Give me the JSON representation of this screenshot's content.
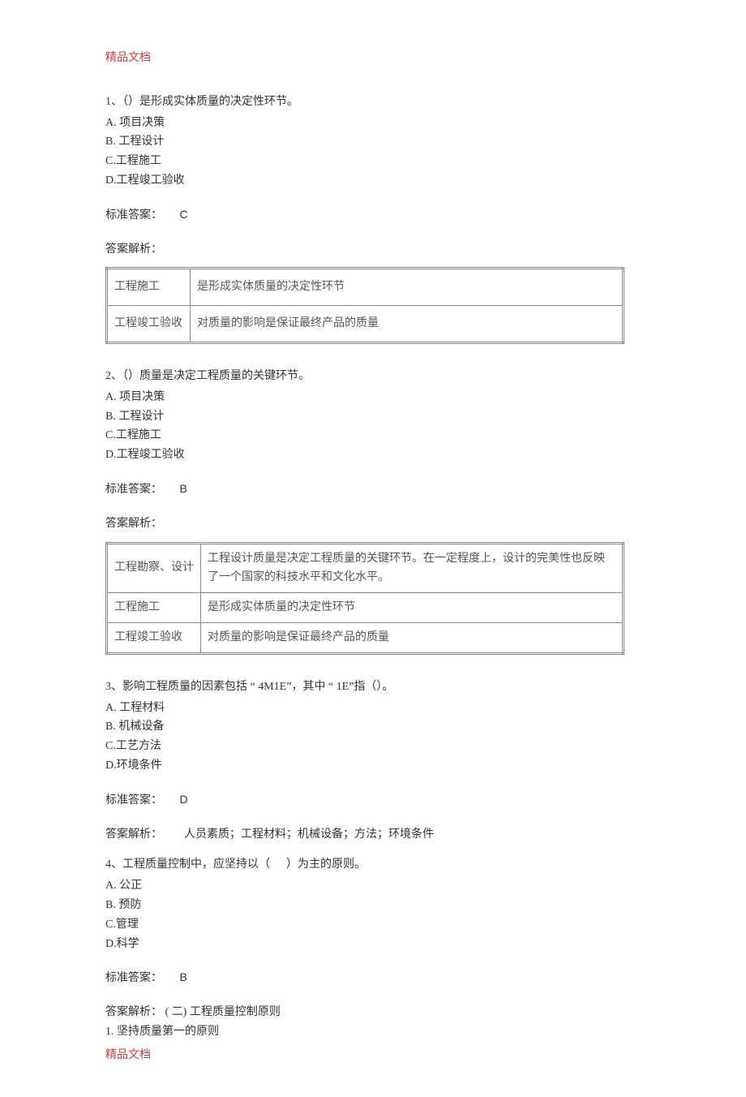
{
  "header": "精品文档",
  "footer": "精品文档",
  "q1": {
    "stem": "1、（）是形成实体质量的决定性环节。",
    "optA": "A. 项目决策",
    "optB": "B. 工程设计",
    "optC": "C.工程施工",
    "optD": "D.工程竣工验收",
    "answer_label": "标准答案：",
    "answer": "C",
    "analysis_label": "答案解析：",
    "table": [
      {
        "c1": "工程施工",
        "c2": "是形成实体质量的决定性环节"
      },
      {
        "c1": "工程竣工验收",
        "c2": "对质量的影响是保证最终产品的质量"
      }
    ]
  },
  "q2": {
    "stem": "2、（）质量是决定工程质量的关键环节。",
    "optA": "A. 项目决策",
    "optB": "B. 工程设计",
    "optC": "C.工程施工",
    "optD": "D.工程竣工验收",
    "answer_label": "标准答案：",
    "answer": "B",
    "analysis_label": "答案解析：",
    "table": [
      {
        "c1": "工程勘察、设计",
        "c2": "工程设计质量是决定工程质量的关键环节。在一定程度上，设计的完美性也反映了一个国家的科技水平和文化水平。"
      },
      {
        "c1": "工程施工",
        "c2": "是形成实体质量的决定性环节"
      },
      {
        "c1": "工程竣工验收",
        "c2": "对质量的影响是保证最终产品的质量"
      }
    ]
  },
  "q3": {
    "stem": "3、影响工程质量的因素包括 “ 4M1E”，其中 “ 1E”指（）。",
    "optA": "A. 工程材料",
    "optB": "B. 机械设备",
    "optC": "C.工艺方法",
    "optD": "D.环境条件",
    "answer_label": "标准答案：",
    "answer": "D",
    "analysis_label": "答案解析：",
    "analysis_text": "人员素质；工程材料；机械设备；方法；环境条件"
  },
  "q4": {
    "stem_pre": "4、工程质量控制中，应坚持以（",
    "stem_post": "）为主的原则。",
    "optA": "A. 公正",
    "optB": "B. 预防",
    "optC": "C.管理",
    "optD": "D.科学",
    "answer_label": "标准答案：",
    "answer": "B",
    "analysis_label": "答案解析：",
    "analysis_text": "( 二) 工程质量控制原则",
    "analysis_line2": "1. 坚持质量第一的原则"
  }
}
